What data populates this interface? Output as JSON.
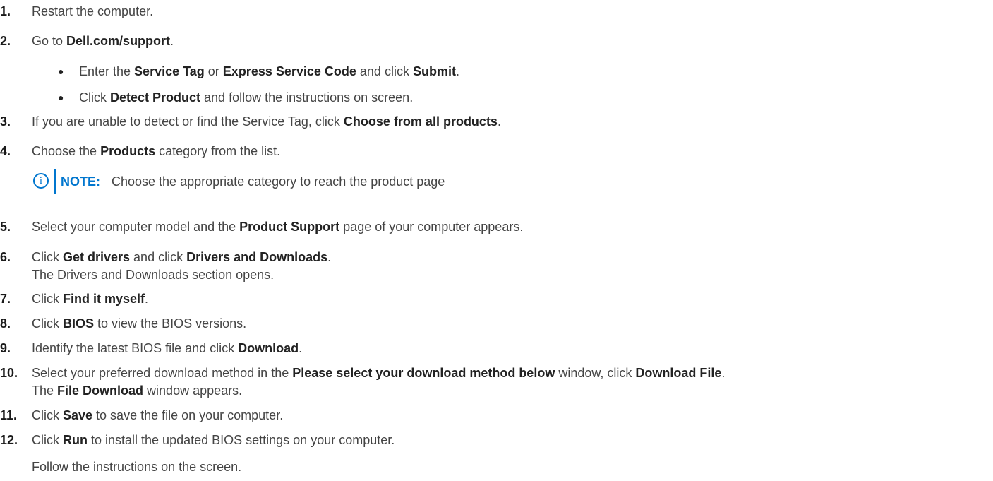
{
  "steps": [
    {
      "num": "1.",
      "parts": [
        {
          "t": "Restart the computer."
        }
      ]
    },
    {
      "num": "2.",
      "parts": [
        {
          "t": "Go to "
        },
        {
          "t": "Dell.com/support",
          "b": true
        },
        {
          "t": "."
        }
      ]
    },
    {
      "num": "3.",
      "parts": [
        {
          "t": "If you are unable to detect or find the Service Tag, click "
        },
        {
          "t": "Choose from all products",
          "b": true
        },
        {
          "t": "."
        }
      ]
    },
    {
      "num": "4.",
      "parts": [
        {
          "t": "Choose the "
        },
        {
          "t": "Products",
          "b": true
        },
        {
          "t": " category from the list."
        }
      ]
    },
    {
      "num": "5.",
      "parts": [
        {
          "t": "Select your computer model and the "
        },
        {
          "t": "Product Support",
          "b": true
        },
        {
          "t": " page of your computer appears."
        }
      ]
    },
    {
      "num": "6.",
      "parts": [
        {
          "t": "Click "
        },
        {
          "t": "Get drivers",
          "b": true
        },
        {
          "t": " and click "
        },
        {
          "t": "Drivers and Downloads",
          "b": true
        },
        {
          "t": "."
        }
      ]
    },
    {
      "num": "7.",
      "parts": [
        {
          "t": "Click "
        },
        {
          "t": "Find it myself",
          "b": true
        },
        {
          "t": "."
        }
      ]
    },
    {
      "num": "8.",
      "parts": [
        {
          "t": "Click "
        },
        {
          "t": "BIOS",
          "b": true
        },
        {
          "t": " to view the BIOS versions."
        }
      ]
    },
    {
      "num": "9.",
      "parts": [
        {
          "t": "Identify the latest BIOS file and click "
        },
        {
          "t": "Download",
          "b": true
        },
        {
          "t": "."
        }
      ]
    },
    {
      "num": "10.",
      "parts": [
        {
          "t": "Select your preferred download method in the "
        },
        {
          "t": "Please select your download method below",
          "b": true
        },
        {
          "t": " window, click "
        },
        {
          "t": "Download File",
          "b": true
        },
        {
          "t": "."
        }
      ]
    },
    {
      "num": "11.",
      "parts": [
        {
          "t": "Click "
        },
        {
          "t": "Save",
          "b": true
        },
        {
          "t": " to save the file on your computer."
        }
      ]
    },
    {
      "num": "12.",
      "parts": [
        {
          "t": "Click "
        },
        {
          "t": "Run",
          "b": true
        },
        {
          "t": " to install the updated BIOS settings on your computer."
        }
      ]
    }
  ],
  "bullets": [
    {
      "parts": [
        {
          "t": "Enter the "
        },
        {
          "t": "Service Tag",
          "b": true
        },
        {
          "t": " or "
        },
        {
          "t": "Express Service Code",
          "b": true
        },
        {
          "t": " and click "
        },
        {
          "t": "Submit",
          "b": true
        },
        {
          "t": "."
        }
      ]
    },
    {
      "parts": [
        {
          "t": "Click "
        },
        {
          "t": "Detect Product",
          "b": true
        },
        {
          "t": " and follow the instructions on screen."
        }
      ]
    }
  ],
  "continuations": {
    "step6": [
      {
        "t": "The Drivers and Downloads section opens."
      }
    ],
    "step10": [
      {
        "t": "The "
      },
      {
        "t": "File Download",
        "b": true
      },
      {
        "t": " window appears."
      }
    ],
    "step12": [
      {
        "t": "Follow the instructions on the screen."
      }
    ]
  },
  "bullet_glyph": "●",
  "note": {
    "icon": "info-icon",
    "icon_glyph": "i",
    "label": "NOTE:",
    "text": "Choose the appropriate category to reach the product page"
  },
  "colors": {
    "accent": "#0076ce",
    "text": "#444444",
    "bold": "#222222"
  }
}
